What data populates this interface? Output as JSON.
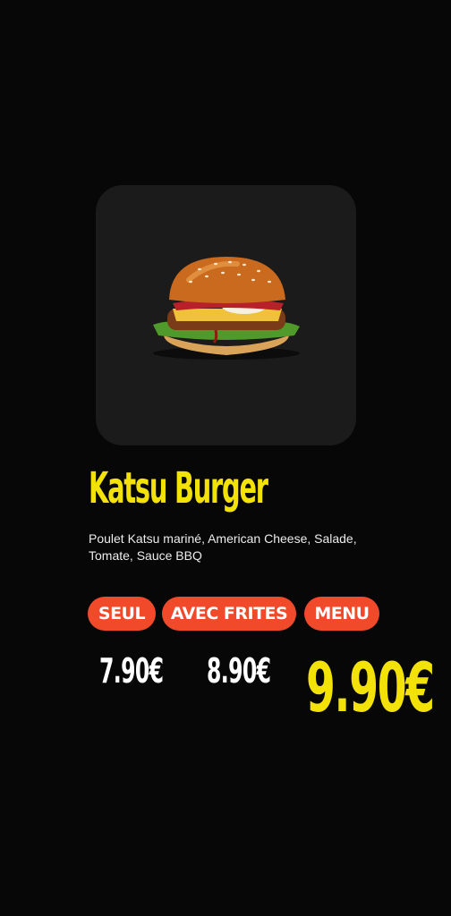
{
  "product": {
    "image_alt": "burger",
    "name": "Katsu Burger",
    "description": "Poulet Katsu mariné, American Cheese, Salade, Tomate, Sauce BBQ"
  },
  "options": [
    {
      "label": "SEUL",
      "price": "7.90€"
    },
    {
      "label": "AVEC FRITES",
      "price": "8.90€"
    },
    {
      "label": "MENU",
      "price": "9.90€"
    }
  ],
  "colors": {
    "background": "#070707",
    "card": "#1b1b1b",
    "accent_yellow": "#f3e207",
    "pill_red": "#f04a2b",
    "text_white": "#ffffff"
  }
}
